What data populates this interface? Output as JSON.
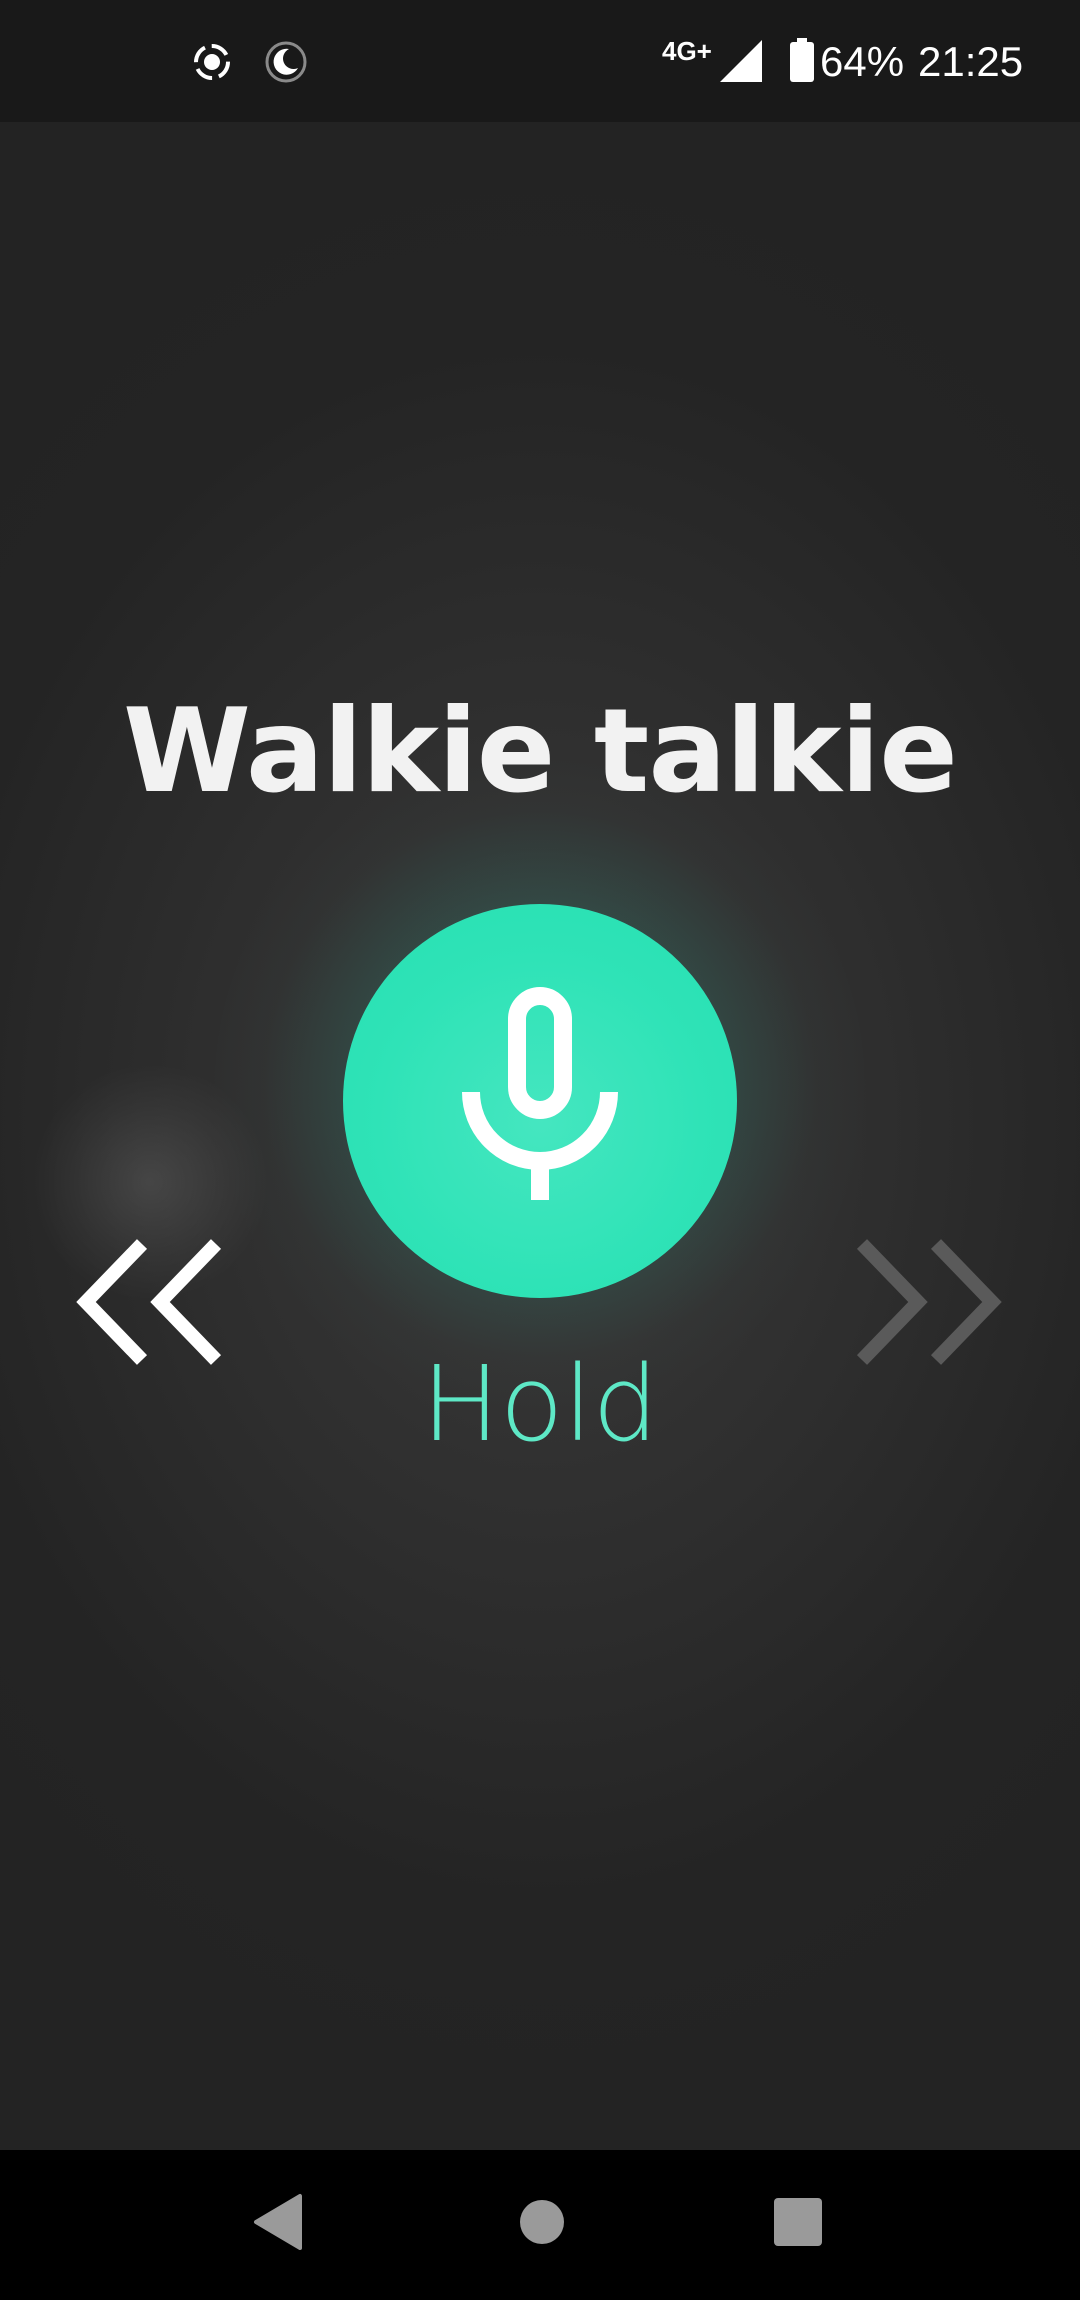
{
  "status_bar": {
    "network_type": "4G+",
    "battery_percent": "64%",
    "time": "21:25",
    "icons": [
      "screen-record-icon",
      "do-not-disturb-moon-icon",
      "cellular-signal-icon",
      "battery-icon"
    ]
  },
  "main": {
    "title": "Walkie talkie",
    "talk_button_icon": "microphone-icon",
    "talk_button_color": "#2ee3b7",
    "hold_label": "Hold",
    "hold_label_color": "#5ee8c6",
    "left_arrow_icon": "double-chevron-left-icon",
    "right_arrow_icon": "double-chevron-right-icon"
  },
  "nav_bar": {
    "buttons": [
      "back-icon",
      "home-icon",
      "recents-icon"
    ]
  }
}
